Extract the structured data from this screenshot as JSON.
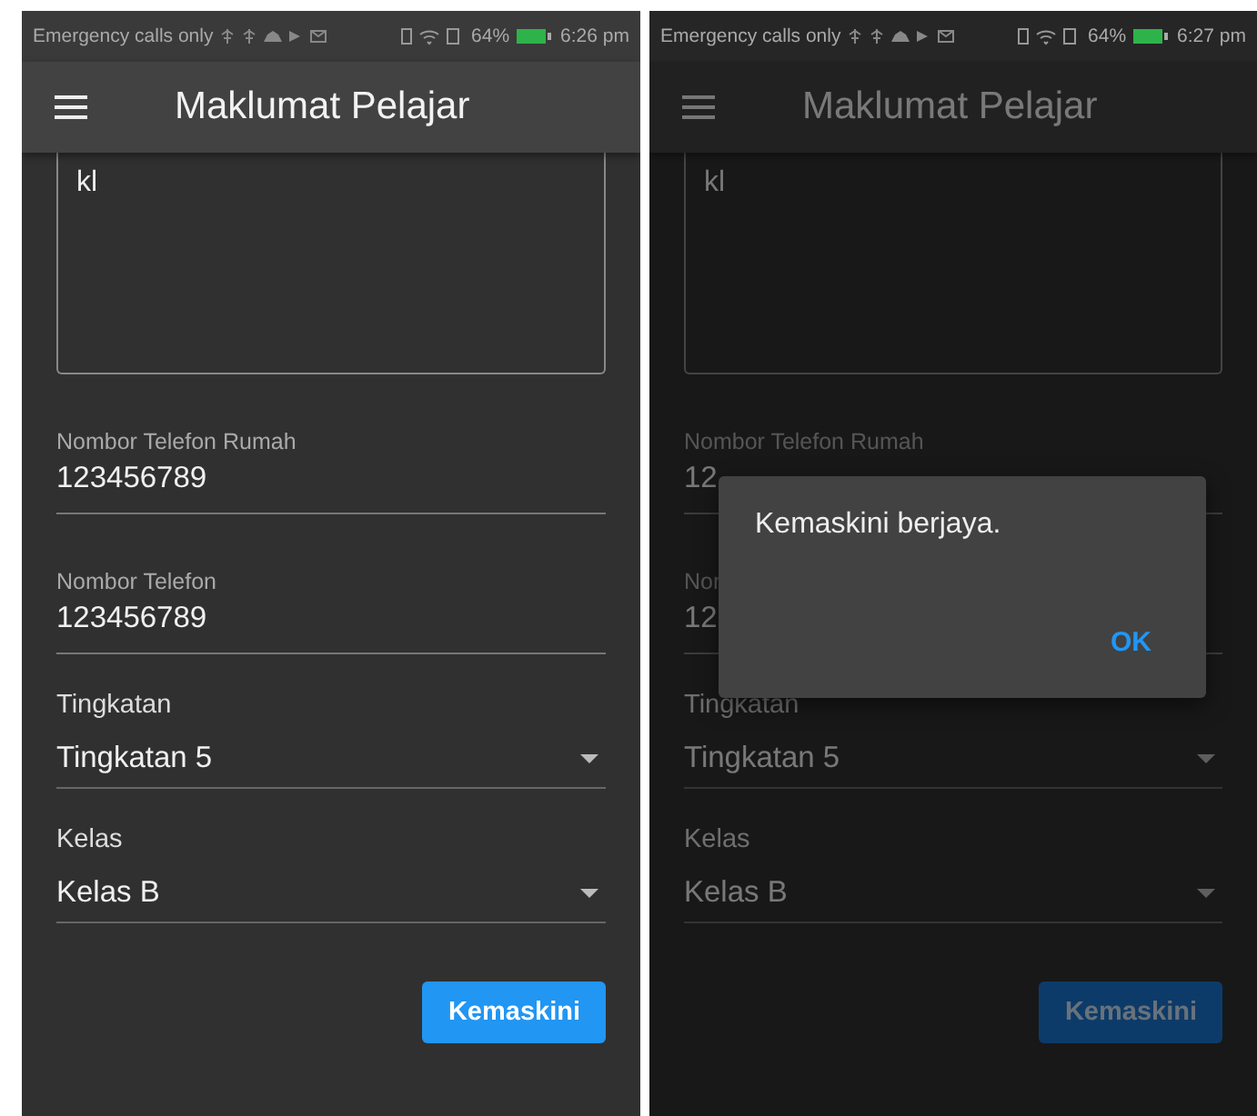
{
  "screens": [
    {
      "status_bar": {
        "carrier": "Emergency calls only",
        "battery": "64%",
        "time": "6:26 pm"
      },
      "title": "Maklumat Pelajar",
      "dimmed": false,
      "fields": [
        {
          "kind": "textarea",
          "value": "kl"
        },
        {
          "kind": "text",
          "label": "Nombor Telefon Rumah",
          "value": "123456789"
        },
        {
          "kind": "text",
          "label": "Nombor Telefon",
          "value": "123456789"
        },
        {
          "kind": "select",
          "label": "Tingkatan",
          "value": "Tingkatan 5"
        },
        {
          "kind": "select",
          "label": "Kelas",
          "value": "Kelas B"
        }
      ],
      "button": {
        "label": "Kemaskini",
        "disabled": false
      }
    },
    {
      "status_bar": {
        "carrier": "Emergency calls only",
        "battery": "64%",
        "time": "6:27 pm"
      },
      "title": "Maklumat Pelajar",
      "dimmed": true,
      "fields": [
        {
          "kind": "textarea",
          "value": "kl"
        },
        {
          "kind": "text",
          "label": "Nombor Telefon Rumah",
          "value": "12"
        },
        {
          "kind": "text",
          "label": "Nor",
          "value": "12"
        },
        {
          "kind": "select",
          "label": "Tingkatan",
          "value": "Tingkatan 5"
        },
        {
          "kind": "select",
          "label": "Kelas",
          "value": "Kelas B"
        }
      ],
      "button": {
        "label": "Kemaskini",
        "disabled": true
      },
      "dialog": {
        "message": "Kemaskini berjaya.",
        "action": "OK"
      }
    }
  ]
}
